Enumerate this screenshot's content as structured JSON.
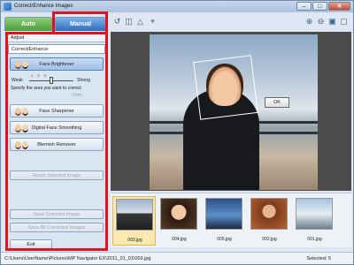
{
  "window": {
    "title": "Correct/Enhance Images"
  },
  "tabs": {
    "auto": "Auto",
    "manual": "Manual"
  },
  "panel": {
    "adjust": "Adjust",
    "section": "Correct/Enhance",
    "face_brightener": "Face Brightener",
    "slider": {
      "weak": "Weak",
      "strong": "Strong",
      "ticks": "1 2 3",
      "level": 2
    },
    "instruction": "Specify the area you want to correct",
    "undo": "Undo",
    "face_sharpener": "Face Sharpener",
    "digital_face_smoothing": "Digital Face Smoothing",
    "blemish_remover": "Blemish Remover",
    "reset_selected": "Reset Selected Image",
    "save_selected": "Save Selected Image",
    "save_all": "Save All Corrected Images",
    "exit": "Exit"
  },
  "toolbar": {
    "icons": [
      "rotate-left-icon",
      "compare-icon",
      "warning-icon",
      "crop-icon",
      "zoom-in-icon",
      "zoom-out-icon",
      "full-screen-icon",
      "fit-icon"
    ]
  },
  "preview": {
    "ok": "OK"
  },
  "filmstrip": {
    "thumbnails": [
      {
        "name": "003.jpg",
        "selected": true
      },
      {
        "name": "004.jpg",
        "selected": false
      },
      {
        "name": "005.jpg",
        "selected": false
      },
      {
        "name": "002.jpg",
        "selected": false
      },
      {
        "name": "001.jpg",
        "selected": false
      }
    ]
  },
  "status": {
    "path": "C:\\Users\\UserName\\Pictures\\MP Navigator EX\\2011_01_01\\003.jpg",
    "selected": "Selected: 5"
  },
  "colors": {
    "highlight": "#e0141e",
    "auto_tab": "#4a9d3b",
    "manual_tab": "#2f6cbf"
  }
}
